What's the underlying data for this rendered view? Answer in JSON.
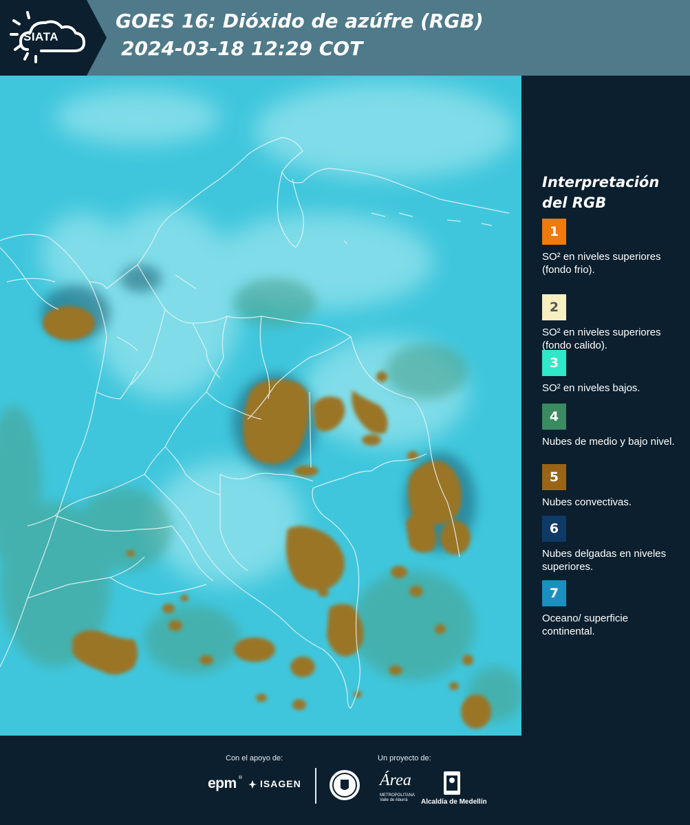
{
  "header": {
    "logo_text": "SIATA",
    "title_line1": "GOES 16: Dióxido de azúfre (RGB)",
    "title_line2": " 2024-03-18 12:29 COT",
    "colors": {
      "header_bg": "#4f7a89",
      "logo_bg": "#0b1f2e"
    }
  },
  "legend": {
    "title": "Interpretación del RGB",
    "items": [
      {
        "number": "1",
        "color": "#f07a0c",
        "label": "SO² en niveles superiores (fondo frio)."
      },
      {
        "number": "2",
        "color": "#f7efbf",
        "label": "SO² en niveles superiores (fondo calido)."
      },
      {
        "number": "3",
        "color": "#2ee8c8",
        "label": "SO² en niveles bajos."
      },
      {
        "number": "4",
        "color": "#3a8a62",
        "label": "Nubes de medio y bajo nivel."
      },
      {
        "number": "5",
        "color": "#9a6416",
        "label": "Nubes convectivas."
      },
      {
        "number": "6",
        "color": "#0f3a66",
        "label": "Nubes delgadas en niveles superiores."
      },
      {
        "number": "7",
        "color": "#1a8fc0",
        "label": "Oceano/ superficie continental."
      }
    ]
  },
  "map": {
    "colors": {
      "surface": "#3fc6dc",
      "clouds_convective": "#9a7426",
      "clouds_low": "#4aa08a",
      "clouds_thin_high": "#a9ecf2",
      "borders": "#e8f4f6"
    }
  },
  "footer": {
    "support_label": "Con el apoyo de:",
    "project_label": "Un proyecto de:",
    "sponsors": {
      "epm": "epm",
      "epm_reg": "®",
      "isagen": "ISAGEN"
    },
    "partners": {
      "area_word": "Área",
      "area_sub_1": "METROPOLITANA",
      "area_sub_2": "Valle de Aburrá",
      "alcaldia": "Alcaldía de Medellín"
    }
  }
}
